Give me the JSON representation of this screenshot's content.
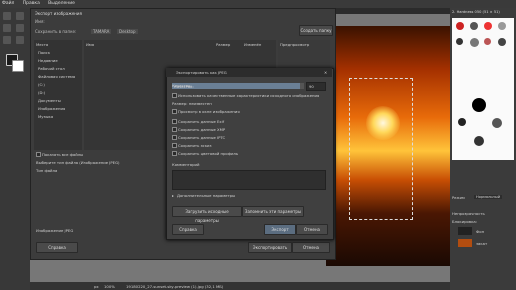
{
  "menubar": {
    "items": [
      "Файл",
      "Правка",
      "Выделение"
    ]
  },
  "file_dialog": {
    "title": "Экспорт изображения",
    "name_label": "Имя:",
    "save_to_folder_label": "Сохранить в папке:",
    "path": [
      "TAMARA",
      "Desktop"
    ],
    "create_folder": "Создать папку",
    "places_header": "Места",
    "places": [
      "Поиск",
      "Недавние",
      "Рабочий стол",
      "Файловая система",
      "(C:)",
      "(D:)",
      "Документы",
      "Изображения",
      "Музыка"
    ],
    "columns": {
      "name": "Имя",
      "size": "Размер",
      "modified": "Изменён"
    },
    "preview_label": "Предпросмотр",
    "show_all_files": "Показать все файлы",
    "select_file_type": "Выберите тип файла (Изображение JPEG)",
    "file_type_header": "Тип файла",
    "file_types": [
      "Изображение JPEG"
    ],
    "help_button": "Справка",
    "export_button": "Экспортировать",
    "cancel_button": "Отмена"
  },
  "jpeg_dialog": {
    "title": "Экспортировать как JPEG",
    "quality_label": "Качество:",
    "quality_value": "90",
    "use_quality_of_original": "Использовать качественные характеристики исходного изображения",
    "size_label": "Размер: неизвестен",
    "preview_in_window": "Просмотр в окне изображения",
    "options": [
      "Сохранить данные Exif",
      "Сохранить данные XMP",
      "Сохранить данные IPTC",
      "Сохранить эскиз",
      "Сохранить цветовой профиль"
    ],
    "comment_label": "Комментарий",
    "advanced": "Дополнительные параметры",
    "load_defaults": "Загрузить исходные параметры",
    "save_defaults": "Запомнить эти параметры",
    "help_button": "Справка",
    "export_button": "Экспорт",
    "cancel_button": "Отмена"
  },
  "right_panel": {
    "brush_label": "2. Hardness 050 (51 × 51)",
    "mode_label": "Режим",
    "mode_value": "Нормальный",
    "layers_label": "Непрозрачность",
    "lock_label": "Блокировка:",
    "layers": [
      "Фон",
      "закат"
    ]
  },
  "statusbar": {
    "unit": "px",
    "zoom": "100%",
    "info": "19180220_27-sunset-sky-preview (1).jpg (32,1 МБ)"
  }
}
